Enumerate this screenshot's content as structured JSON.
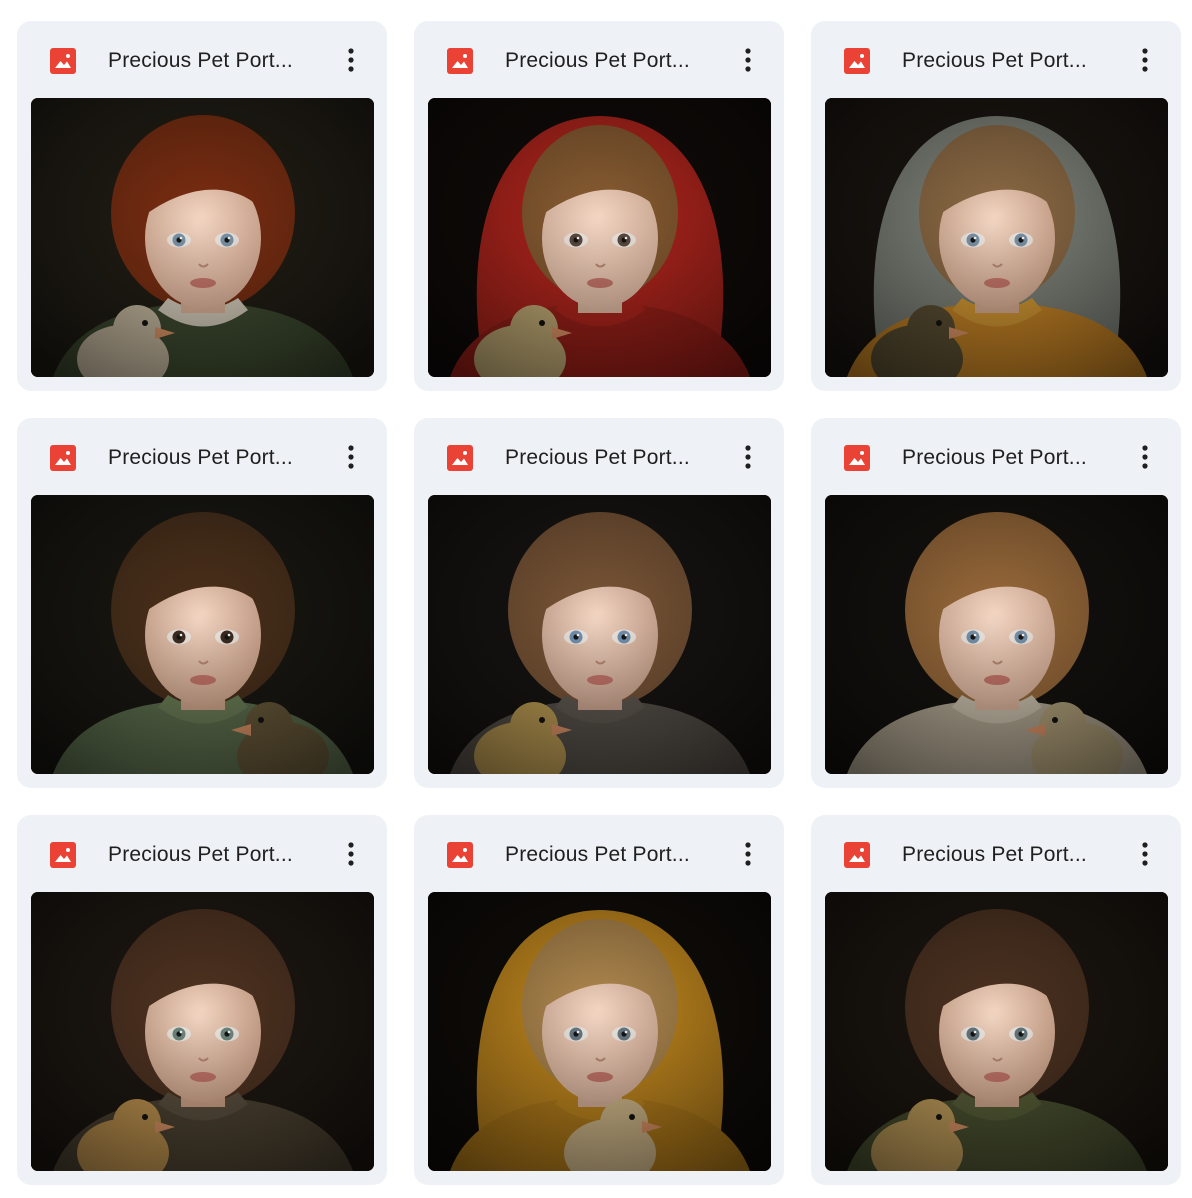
{
  "files": [
    {
      "title": "Precious Pet Port...",
      "icon": "image-file-icon",
      "menu_icon": "more-vertical-icon",
      "thumbnail": {
        "bg": "#1d1a13",
        "hair": "#7a2c10",
        "skin": "#e2b59c",
        "eyes": "#7d97ad",
        "hood": "",
        "clothing": "#3c4a2f",
        "collar": "#d9d2c0",
        "chick": "#cdbfa6",
        "chick_side": "left"
      }
    },
    {
      "title": "Precious Pet Port...",
      "icon": "image-file-icon",
      "menu_icon": "more-vertical-icon",
      "thumbnail": {
        "bg": "#0e0a08",
        "hair": "#8a5d32",
        "skin": "#e8c0a8",
        "eyes": "#5a4a3e",
        "hood": "#b3241c",
        "clothing": "#9e1f18",
        "collar": "#b3241c",
        "chick": "#c9b27a",
        "chick_side": "left"
      }
    },
    {
      "title": "Precious Pet Port...",
      "icon": "image-file-icon",
      "menu_icon": "more-vertical-icon",
      "thumbnail": {
        "bg": "#17130f",
        "hair": "#8c6a44",
        "skin": "#dcb095",
        "eyes": "#7d95aa",
        "hood": "#7d837a",
        "clothing": "#c98524",
        "collar": "#d69a32",
        "chick": "#5a4f32",
        "chick_side": "left"
      }
    },
    {
      "title": "Precious Pet Port...",
      "icon": "image-file-icon",
      "menu_icon": "more-vertical-icon",
      "thumbnail": {
        "bg": "#161510",
        "hair": "#4a2f1a",
        "skin": "#d9ac92",
        "eyes": "#3d2a1f",
        "hood": "",
        "clothing": "#5f7250",
        "collar": "#6d8058",
        "chick": "#6a5a3a",
        "chick_side": "right"
      }
    },
    {
      "title": "Precious Pet Port...",
      "icon": "image-file-icon",
      "menu_icon": "more-vertical-icon",
      "thumbnail": {
        "bg": "#141210",
        "hair": "#7a5536",
        "skin": "#d8ae98",
        "eyes": "#7694b3",
        "hood": "",
        "clothing": "#57514a",
        "collar": "#615a52",
        "chick": "#c4a256",
        "chick_side": "left"
      }
    },
    {
      "title": "Precious Pet Port...",
      "icon": "image-file-icon",
      "menu_icon": "more-vertical-icon",
      "thumbnail": {
        "bg": "#12100d",
        "hair": "#9a6a3a",
        "skin": "#e2b8a0",
        "eyes": "#7a95ad",
        "hood": "",
        "clothing": "#b8ad98",
        "collar": "#cfc6b2",
        "chick": "#b8a77f",
        "chick_side": "right"
      }
    },
    {
      "title": "Precious Pet Port...",
      "icon": "image-file-icon",
      "menu_icon": "more-vertical-icon",
      "thumbnail": {
        "bg": "#1a1510",
        "hair": "#4e3220",
        "skin": "#d8ab90",
        "eyes": "#6f8a80",
        "hood": "",
        "clothing": "#4d4332",
        "collar": "#5c5140",
        "chick": "#c89a52",
        "chick_side": "left"
      }
    },
    {
      "title": "Precious Pet Port...",
      "icon": "image-file-icon",
      "menu_icon": "more-vertical-icon",
      "thumbnail": {
        "bg": "#0e0b08",
        "hair": "#b0884e",
        "skin": "#e0b8a0",
        "eyes": "#6a7a86",
        "hood": "#c58a1e",
        "clothing": "#b9801a",
        "collar": "#c58a1e",
        "chick": "#d9c090",
        "chick_side": "center"
      }
    },
    {
      "title": "Precious Pet Port...",
      "icon": "image-file-icon",
      "menu_icon": "more-vertical-icon",
      "thumbnail": {
        "bg": "#18130e",
        "hair": "#4b3120",
        "skin": "#d9ad92",
        "eyes": "#667a80",
        "hood": "",
        "clothing": "#4a5230",
        "collar": "#586038",
        "chick": "#c9a45e",
        "chick_side": "left"
      }
    }
  ]
}
